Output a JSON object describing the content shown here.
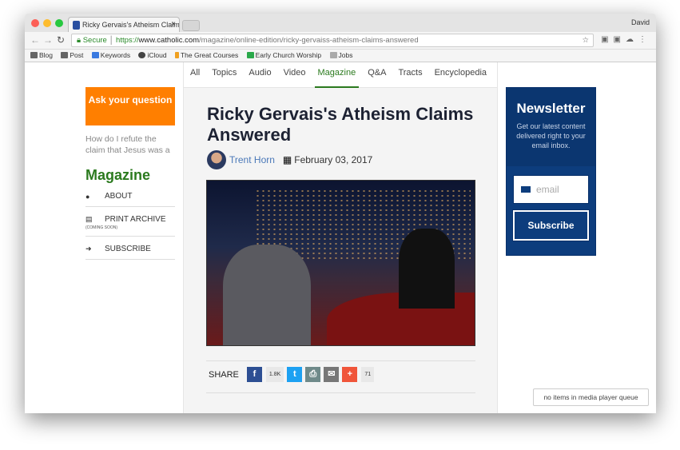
{
  "browser": {
    "tab_title": "Ricky Gervais's Atheism Claims Answered",
    "user": "David",
    "secure_label": "Secure",
    "url_scheme": "https://",
    "url_domain": "www.catholic.com",
    "url_path": "/magazine/online-edition/ricky-gervaiss-atheism-claims-answered",
    "bookmarks": [
      "Blog",
      "Post",
      "Keywords",
      "iCloud",
      "The Great Courses",
      "Early Church Worship",
      "Jobs"
    ]
  },
  "nav": {
    "tabs": [
      "All",
      "Topics",
      "Audio",
      "Video",
      "Magazine",
      "Q&A",
      "Tracts",
      "Encyclopedia"
    ],
    "active": "Magazine"
  },
  "sidebar": {
    "ask_label": "Ask your question",
    "question_teaser": "How do I refute the claim that Jesus was a",
    "section_title": "Magazine",
    "items": [
      {
        "label": "ABOUT",
        "icon": "info-icon"
      },
      {
        "label": "PRINT ARCHIVE",
        "note": "(COMING SOON)",
        "icon": "newspaper-icon"
      },
      {
        "label": "SUBSCRIBE",
        "icon": "sign-in-icon"
      }
    ]
  },
  "article": {
    "title": "Ricky Gervais's Atheism Claims Answered",
    "author": "Trent Horn",
    "date": "February 03, 2017",
    "share": {
      "label": "SHARE",
      "facebook_count": "1.8K",
      "total_count": "71"
    }
  },
  "newsletter": {
    "title": "Newsletter",
    "text": "Get our latest content delivered right to your email inbox.",
    "email_placeholder": "email",
    "subscribe_label": "Subscribe"
  },
  "media_queue": "no items in media player queue",
  "colors": {
    "accent_green": "#2b7a1e",
    "ask_orange": "#ff7f00",
    "newsletter_blue": "#0d3d7d"
  }
}
